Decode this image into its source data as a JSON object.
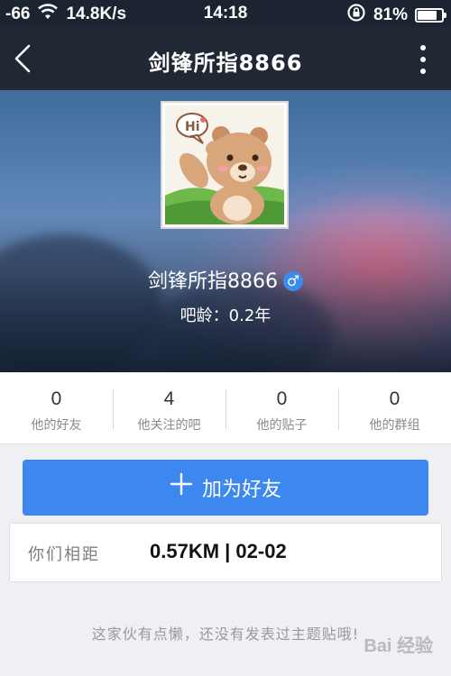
{
  "status_bar": {
    "signal": "-66",
    "speed": "14.8K/s",
    "time": "14:18",
    "battery": "81%",
    "battery_level": 0.81
  },
  "nav": {
    "title": "剑锋所指8866"
  },
  "profile": {
    "username": "剑锋所指8866",
    "gender_symbol": "♂",
    "age_text": "吧龄：0.2年",
    "avatar_bubble_text": "Hi"
  },
  "stats": [
    {
      "value": "0",
      "label": "他的好友"
    },
    {
      "value": "4",
      "label": "他关注的吧"
    },
    {
      "value": "0",
      "label": "他的贴子"
    },
    {
      "value": "0",
      "label": "他的群组"
    }
  ],
  "add_friend": {
    "label": "加为好友",
    "icon": "plus-icon"
  },
  "distance": {
    "label": "你们相距",
    "value": "0.57KM | 02-02"
  },
  "empty_note": "这家伙有点懒，还没有发表过主题贴哦!",
  "watermark": "Bai 经验",
  "colors": {
    "accent": "#3d88ef",
    "nav_bg": "#1f2833",
    "page_bg": "#efeff4"
  }
}
